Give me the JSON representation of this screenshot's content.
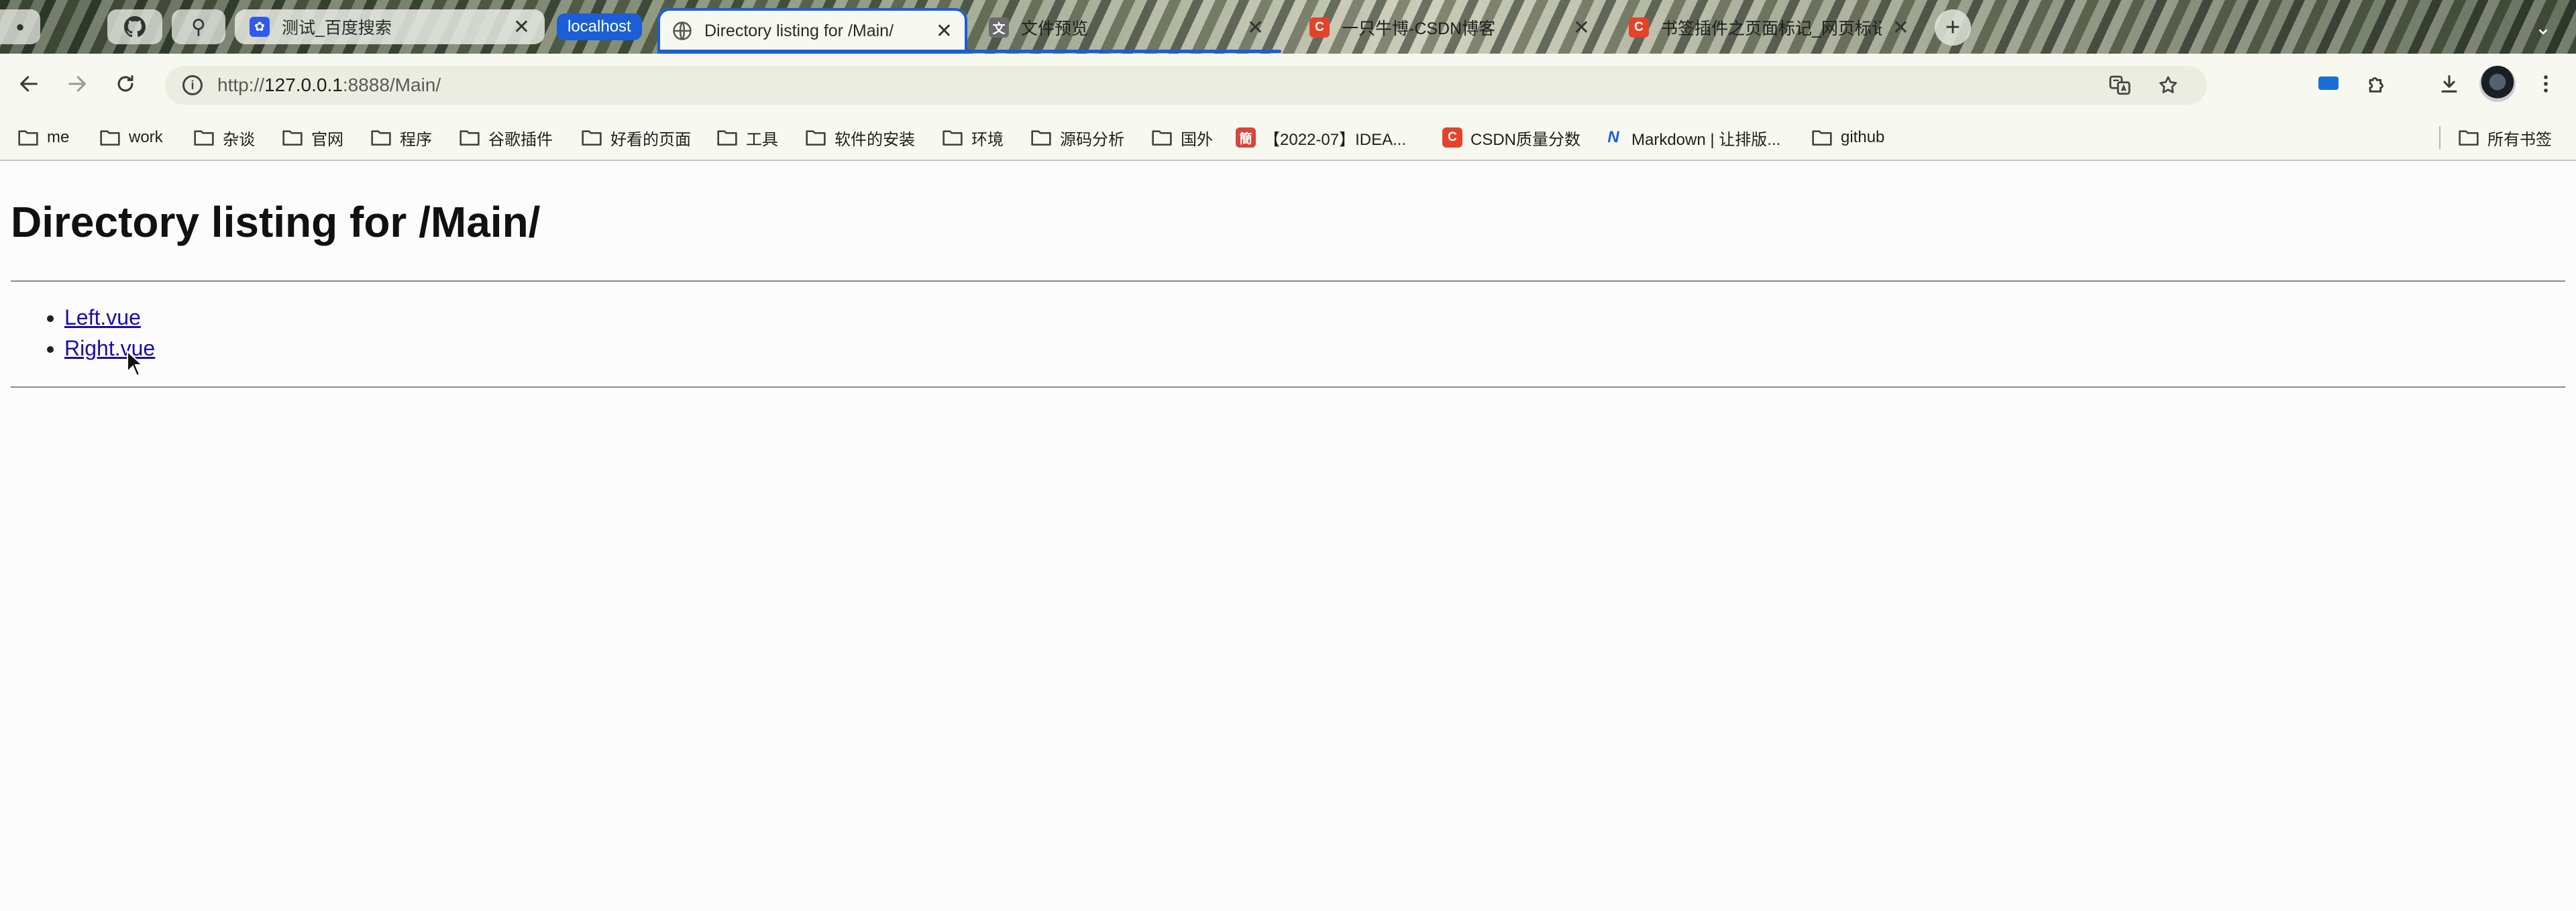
{
  "browser": {
    "tabs": [
      {
        "title": "测试_百度搜索",
        "close": "✕"
      },
      {
        "title": "Directory listing for /Main/",
        "close": "✕",
        "active": true
      },
      {
        "title": "文件预览",
        "close": "✕"
      },
      {
        "title": "一只牛博-CSDN博客",
        "close": "✕"
      },
      {
        "title": "书签插件之页面标记_网页标记",
        "close": "✕"
      }
    ],
    "tab_group_label": "localhost",
    "new_tab_label": "+",
    "address": {
      "scheme": "http://",
      "host": "127.0.0.1",
      "rest": ":8888/Main/"
    },
    "bookmarks": [
      {
        "label": "me"
      },
      {
        "label": "work"
      },
      {
        "label": "杂谈"
      },
      {
        "label": "官网"
      },
      {
        "label": "程序"
      },
      {
        "label": "谷歌插件"
      },
      {
        "label": "好看的页面"
      },
      {
        "label": "工具"
      },
      {
        "label": "软件的安装"
      },
      {
        "label": "环境"
      },
      {
        "label": "源码分析"
      },
      {
        "label": "国外"
      },
      {
        "label": "【2022-07】IDEA..."
      },
      {
        "label": "CSDN质量分数"
      },
      {
        "label": "Markdown | 让排版..."
      },
      {
        "label": "github"
      },
      {
        "label": "所有书签"
      }
    ]
  },
  "page": {
    "heading": "Directory listing for /Main/",
    "files": [
      "Left.vue",
      "Right.vue"
    ]
  },
  "colors": {
    "accent": "#1a5fd6",
    "link": "#1a0dab",
    "csdn": "#e4422b"
  }
}
